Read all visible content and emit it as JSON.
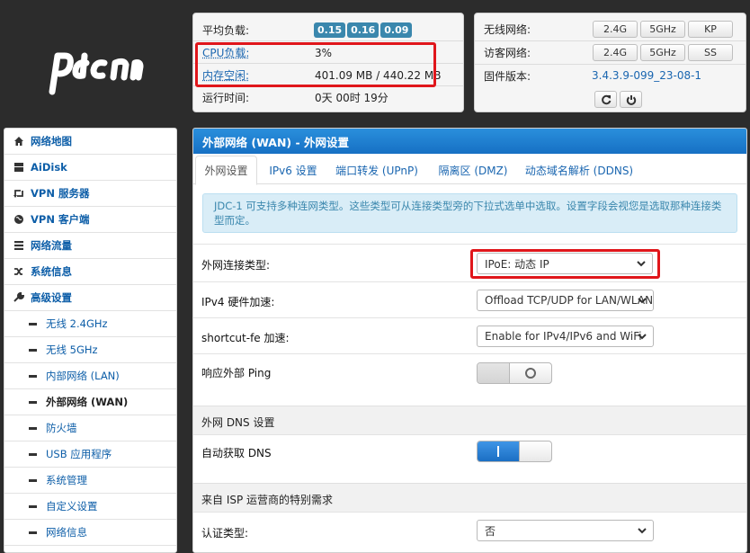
{
  "logo": {
    "text": "pdcn"
  },
  "status": {
    "load_label": "平均负载:",
    "load_values": [
      "0.15",
      "0.16",
      "0.09"
    ],
    "cpu_label": "CPU负载:",
    "cpu_value": "3%",
    "mem_label": "内存空闲:",
    "mem_value": "401.09 MB / 440.22 MB",
    "uptime_label": "运行时间:",
    "uptime_value": "0天 00时 19分"
  },
  "wireless": {
    "wifi_label": "无线网络:",
    "wifi_buttons": [
      "2.4G",
      "5GHz",
      "KP"
    ],
    "guest_label": "访客网络:",
    "guest_buttons": [
      "2.4G",
      "5GHz",
      "SS"
    ],
    "firmware_label": "固件版本:",
    "firmware_value": "3.4.3.9-099_23-08-1"
  },
  "sidebar": {
    "items": [
      {
        "label": "网络地图",
        "icon": "home-icon"
      },
      {
        "label": "AiDisk",
        "icon": "disk-icon"
      },
      {
        "label": "VPN 服务器",
        "icon": "retweet-icon"
      },
      {
        "label": "VPN 客户端",
        "icon": "globe-icon"
      },
      {
        "label": "网络流量",
        "icon": "list-icon"
      },
      {
        "label": "系统信息",
        "icon": "random-icon"
      },
      {
        "label": "高级设置",
        "icon": "wrench-icon"
      }
    ],
    "subitems": [
      "无线 2.4GHz",
      "无线 5GHz",
      "内部网络 (LAN)",
      "外部网络 (WAN)",
      "防火墙",
      "USB 应用程序",
      "系统管理",
      "自定义设置",
      "网络信息"
    ],
    "active_sub": "外部网络 (WAN)"
  },
  "panel": {
    "title": "外部网络 (WAN) - 外网设置",
    "tabs": [
      "外网设置",
      "IPv6 设置",
      "端口转发 (UPnP)",
      "隔离区 (DMZ)",
      "动态域名解析 (DDNS)"
    ],
    "info": "JDC-1 可支持多种连网类型。这些类型可从连接类型旁的下拉式选单中选取。设置字段会视您是选取那种连接类型而定。",
    "conn_type_label": "外网连接类型:",
    "conn_type_value": "IPoE: 动态 IP",
    "hwaccel_label": "IPv4 硬件加速:",
    "hwaccel_value": "Offload TCP/UDP for LAN/WLAN",
    "shortcut_label": "shortcut-fe 加速:",
    "shortcut_value": "Enable for IPv4/IPv6 and WiFi",
    "ping_label": "响应外部 Ping",
    "dns_section": "外网 DNS 设置",
    "auto_dns_label": "自动获取 DNS",
    "isp_section": "来自 ISP 运营商的特别需求",
    "auth_label": "认证类型:",
    "auth_value": "否"
  },
  "colors": {
    "accent": "#1670c4",
    "badge": "#3a87ad",
    "highlight": "#e0161b"
  }
}
